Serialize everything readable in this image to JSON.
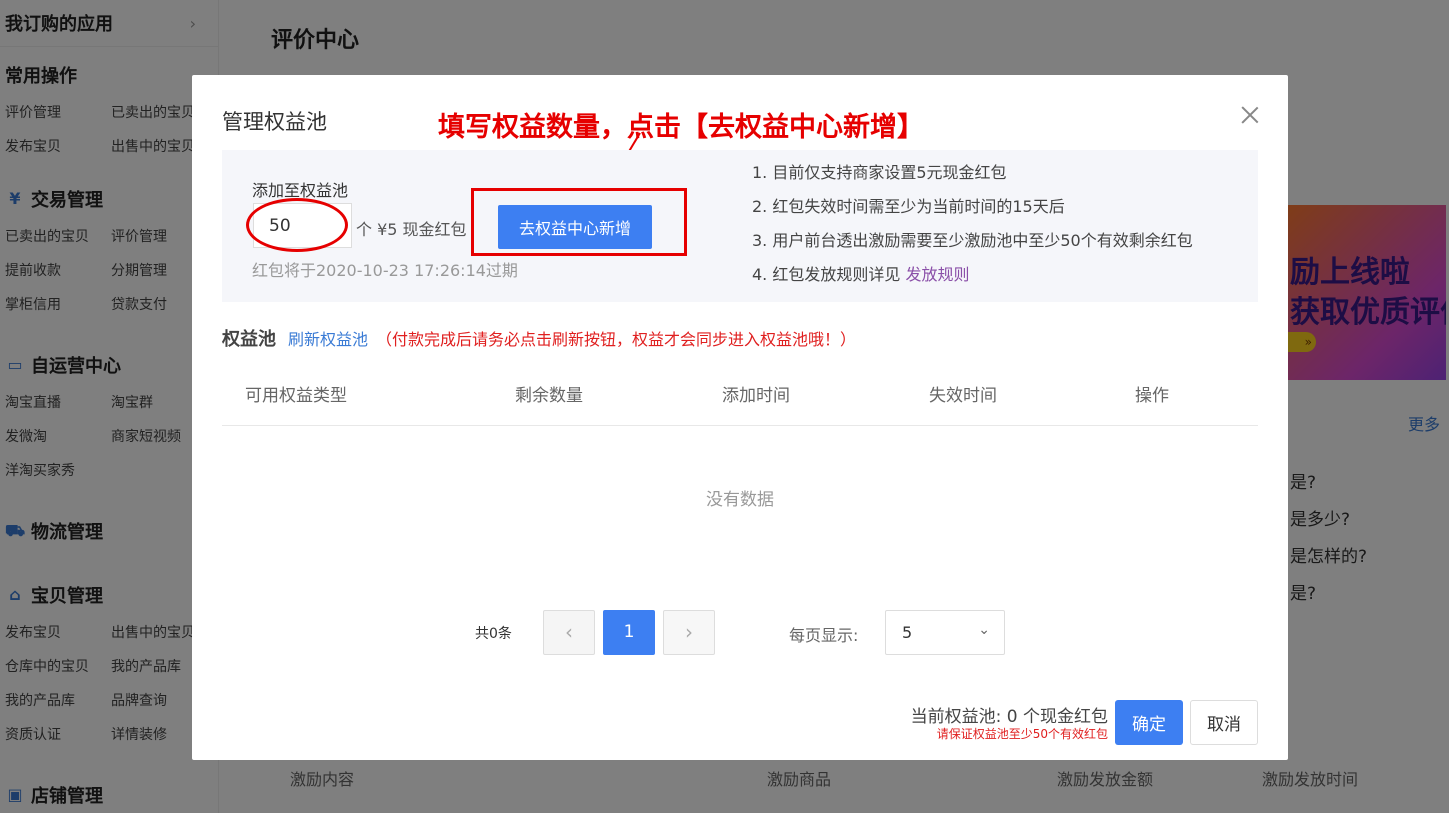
{
  "sidebar": {
    "top": "我订购的应用",
    "sections": [
      {
        "title": "常用操作",
        "icon": "",
        "items": [
          "评价管理",
          "已卖出的宝贝",
          "发布宝贝",
          "出售中的宝贝"
        ]
      },
      {
        "title": "交易管理",
        "icon": "yen-circle-icon",
        "items": [
          "已卖出的宝贝",
          "评价管理",
          "提前收款",
          "分期管理",
          "掌柜信用",
          "贷款支付"
        ]
      },
      {
        "title": "自运营中心",
        "icon": "chat-icon",
        "items": [
          "淘宝直播",
          "淘宝群",
          "发微淘",
          "商家短视频",
          "洋淘买家秀"
        ]
      },
      {
        "title": "物流管理",
        "icon": "truck-icon",
        "items": []
      },
      {
        "title": "宝贝管理",
        "icon": "bag-icon",
        "items": [
          "发布宝贝",
          "出售中的宝贝",
          "仓库中的宝贝",
          "我的产品库",
          "我的产品库",
          "品牌查询",
          "资质认证",
          "详情装修"
        ]
      },
      {
        "title": "店铺管理",
        "icon": "shop-icon",
        "items": []
      }
    ]
  },
  "background": {
    "title": "评价中心",
    "banner_line1": "励上线啦",
    "banner_line2": "获取优质评价",
    "banner_arrow": "»",
    "more": "更多",
    "questions": [
      "是?",
      "是多少?",
      "是怎样的?",
      "是?"
    ],
    "footer_cols": [
      "激励内容",
      "激励商品",
      "激励发放金额",
      "激励发放时间"
    ]
  },
  "modal": {
    "title": "管理权益池",
    "annotation": "填写权益数量，点击【去权益中心新增】",
    "add_label": "添加至权益池",
    "quantity": "50",
    "unit_text": "个 ¥5 现金红包",
    "expire_text": "红包将于2020-10-23 17:26:14过期",
    "add_button": "去权益中心新增",
    "rules": [
      "1. 目前仅支持商家设置5元现金红包",
      "2. 红包失效时间需至少为当前时间的15天后",
      "3. 用户前台透出激励需要至少激励池中至少50个有效剩余红包",
      "4. 红包发放规则详见"
    ],
    "rules_link": "发放规则",
    "pool_title": "权益池",
    "refresh_link": "刷新权益池",
    "pool_note": "（付款完成后请务必点击刷新按钮，权益才会同步进入权益池哦！）",
    "table_headers": [
      "可用权益类型",
      "剩余数量",
      "添加时间",
      "失效时间",
      "操作"
    ],
    "empty_text": "没有数据",
    "pager": {
      "total": "共0条",
      "current": "1",
      "page_size_label": "每页显示:",
      "page_size": "5"
    },
    "current_pool": "当前权益池: 0 个现金红包",
    "warning": "请保证权益池至少50个有效红包",
    "ok_button": "确定",
    "cancel_button": "取消"
  },
  "colors": {
    "primary": "#3d7ff2",
    "annotation_red": "#e60000",
    "warning_red": "#e02020",
    "link_purple": "#8a4fa8"
  }
}
